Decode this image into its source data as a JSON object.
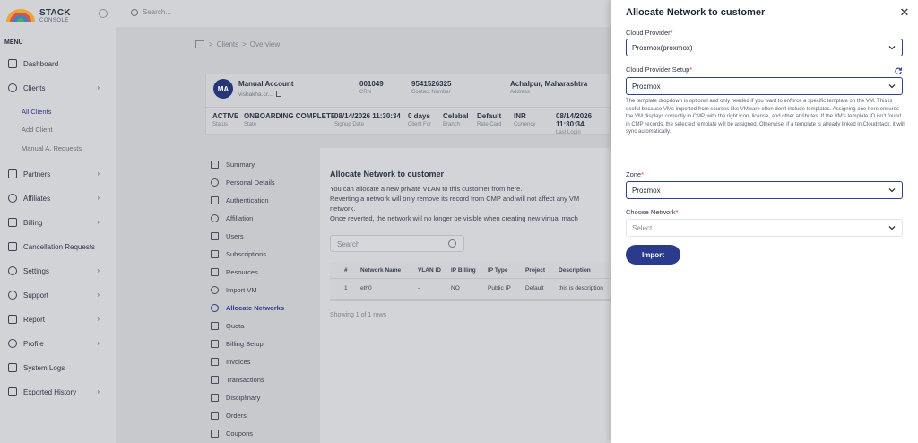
{
  "brand": {
    "name": "STACK",
    "sub": "CONSOLE"
  },
  "sidebar": {
    "menu_caption": "MENU",
    "items": [
      {
        "label": "Dashboard",
        "icon": "home-icon",
        "chevron": false
      },
      {
        "label": "Clients",
        "icon": "user-icon",
        "chevron": true
      },
      {
        "label": "Partners",
        "icon": "users-icon",
        "chevron": true
      },
      {
        "label": "Affiliates",
        "icon": "eye-icon",
        "chevron": true
      },
      {
        "label": "Billing",
        "icon": "file-icon",
        "chevron": true
      },
      {
        "label": "Cancellation Requests",
        "icon": "document-icon",
        "chevron": false
      },
      {
        "label": "Settings",
        "icon": "gear-icon",
        "chevron": true
      },
      {
        "label": "Support",
        "icon": "headset-icon",
        "chevron": true
      },
      {
        "label": "Report",
        "icon": "report-icon",
        "chevron": true
      },
      {
        "label": "Profile",
        "icon": "profile-icon",
        "chevron": true
      },
      {
        "label": "System Logs",
        "icon": "logs-icon",
        "chevron": false
      },
      {
        "label": "Exported History",
        "icon": "export-icon",
        "chevron": true
      }
    ],
    "sub_items": [
      "All Clients",
      "Add Client",
      "Manual A. Requests"
    ]
  },
  "topbar": {
    "search_placeholder": "Search..."
  },
  "breadcrumb": {
    "sep": ">",
    "items": [
      "Clients",
      "Overview"
    ]
  },
  "account": {
    "initials": "MA",
    "name": "Manual Account",
    "email": "vishakha.cr...",
    "crn": {
      "value": "001049",
      "label": "CRN"
    },
    "contact": {
      "value": "9541526325",
      "label": "Contact Number"
    },
    "address": {
      "value": "Achalpur, Maharashtra",
      "label": "Address"
    },
    "stats": [
      {
        "value": "ACTIVE",
        "label": "Status"
      },
      {
        "value": "ONBOARDING COMPLETE",
        "label": "State"
      },
      {
        "value": "08/14/2026 11:30:34",
        "label": "Signup Date"
      },
      {
        "value": "0 days",
        "label": "Client For"
      },
      {
        "value": "Celebal",
        "label": "Branch"
      },
      {
        "value": "Default",
        "label": "Rate Card"
      },
      {
        "value": "INR",
        "label": "Currency"
      },
      {
        "value": "08/14/2026 11:30:34",
        "label": "Last Login"
      }
    ]
  },
  "tabs": [
    {
      "label": "Summary",
      "icon": "grid-icon"
    },
    {
      "label": "Personal Details",
      "icon": "person-icon"
    },
    {
      "label": "Authentication",
      "icon": "lock-icon"
    },
    {
      "label": "Affiliation",
      "icon": "affiliation-icon"
    },
    {
      "label": "Users",
      "icon": "users-icon"
    },
    {
      "label": "Subscriptions",
      "icon": "bookmark-icon"
    },
    {
      "label": "Resources",
      "icon": "layers-icon"
    },
    {
      "label": "Import VM",
      "icon": "cloud-icon"
    },
    {
      "label": "Allocate Networks",
      "icon": "network-icon"
    },
    {
      "label": "Quota",
      "icon": "quota-icon"
    },
    {
      "label": "Billing Setup",
      "icon": "barcode-icon"
    },
    {
      "label": "Invoices",
      "icon": "invoice-icon"
    },
    {
      "label": "Transactions",
      "icon": "card-icon"
    },
    {
      "label": "Disciplinary",
      "icon": "warning-icon"
    },
    {
      "label": "Orders",
      "icon": "orders-icon"
    },
    {
      "label": "Coupons",
      "icon": "tag-icon"
    }
  ],
  "active_tab": "Allocate Networks",
  "content": {
    "title": "Allocate Network to customer",
    "desc_lines": [
      "You can allocate a new private VLAN to this customer from here.",
      "Reverting a network will only remove its record from CMP and will not affect any VM",
      "network.",
      "Once reverted, the network will no longer be visible when creating new virtual mach"
    ],
    "search_placeholder": "Search",
    "table": {
      "headers": [
        "#",
        "Network Name",
        "VLAN ID",
        "IP Billing",
        "IP Type",
        "Project",
        "Description"
      ],
      "rows": [
        [
          "1",
          "eth0",
          "-",
          "NO",
          "Public IP",
          "Default",
          "this is description"
        ]
      ]
    },
    "footer": "Showing 1 of 1 rows"
  },
  "drawer": {
    "title": "Allocate Network to customer",
    "close_icon": "close-icon",
    "cloud_provider": {
      "label": "Cloud Provider",
      "value": "Proxmox(proxmox)"
    },
    "cloud_setup": {
      "label": "Cloud Provider Setup",
      "value": "Proxmox"
    },
    "help_text": "The template dropdown is optional and only needed if you want to enforce a specific template on the VM. This is useful because VMs imported from sources like VMware often don't include templates. Assigning one here ensures the VM displays correctly in CMP, with the right icon, license, and other attributes. If the VM's template ID isn't found in CMP records, the selected template will be assigned. Otherwise, if a template is already linked in Cloudstack, it will sync automatically.",
    "zone": {
      "label": "Zone",
      "value": "Proxmox"
    },
    "network": {
      "label": "Choose Network",
      "placeholder": "Select..."
    },
    "required_mark": "*",
    "import_label": "Import"
  },
  "colors": {
    "primary": "#2a3b8d",
    "required": "#d93838",
    "overlay": "#c8c9cc"
  }
}
